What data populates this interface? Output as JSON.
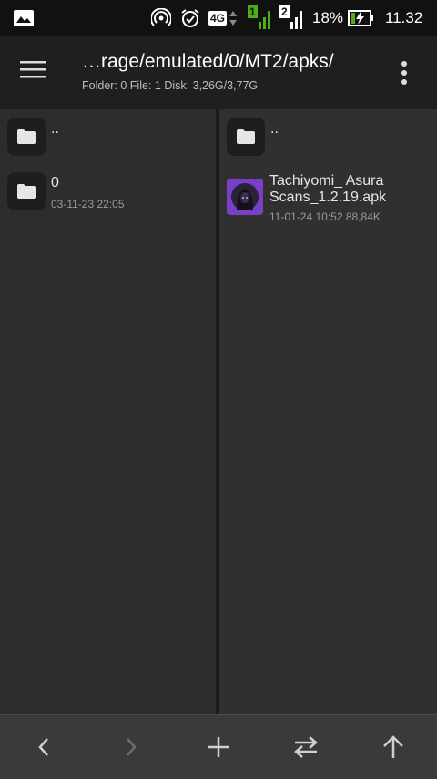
{
  "status_bar": {
    "network_type": "4G",
    "sim1_label": "1",
    "sim2_label": "2",
    "battery_percent": "18%",
    "time": "11.32"
  },
  "toolbar": {
    "path": "…rage/emulated/0/MT2/apks/",
    "info": "Folder: 0  File: 1  Disk: 3,26G/3,77G"
  },
  "left_pane": {
    "items": [
      {
        "name": "..",
        "meta": "",
        "icon": "folder-icon"
      },
      {
        "name": "0",
        "meta": "03-11-23 22:05",
        "icon": "folder-icon"
      }
    ]
  },
  "right_pane": {
    "items": [
      {
        "name": "..",
        "meta": "",
        "icon": "folder-icon"
      },
      {
        "name_line1": "Tachiyomi_ Asura",
        "name_line2": "Scans_1.2.19.apk",
        "meta": "11-01-24 10:52   88,84K",
        "icon": "apk-icon"
      }
    ]
  },
  "bottom_bar": {
    "buttons": [
      "back-icon",
      "forward-icon",
      "add-icon",
      "swap-icon",
      "up-icon"
    ]
  },
  "colors": {
    "background": "#2b2b2b",
    "toolbar": "#1f1f1f",
    "statusbar": "#111111",
    "signal_green": "#4caf1a",
    "apk_purple": "#7a3fc7"
  }
}
